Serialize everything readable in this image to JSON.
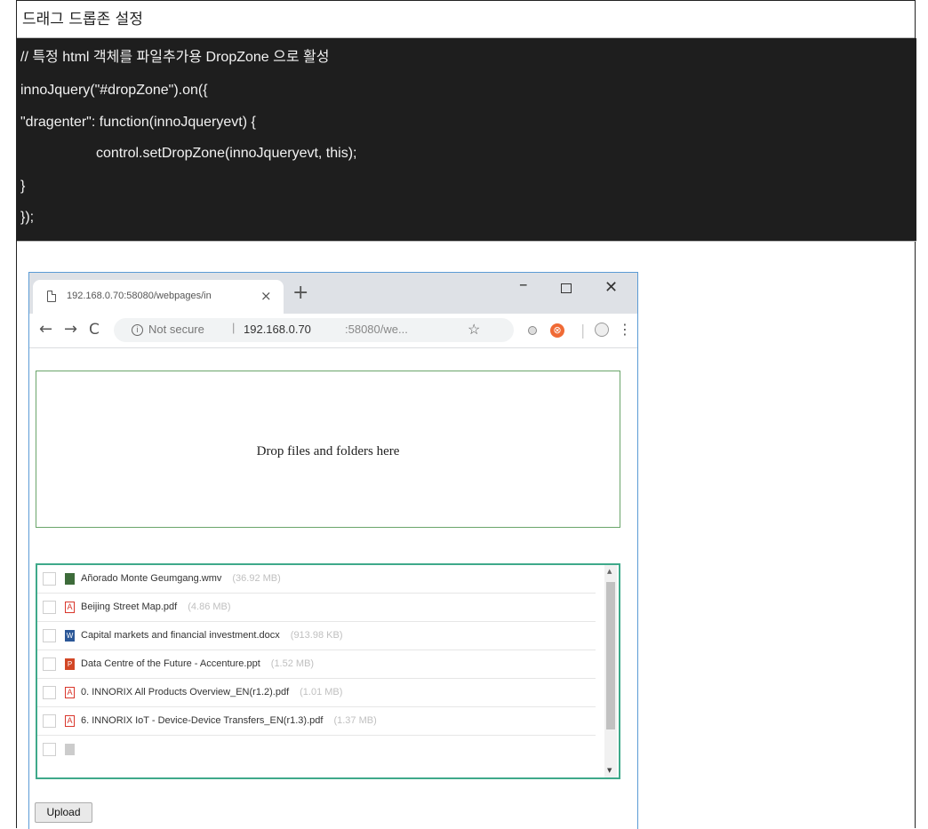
{
  "heading": "드래그 드롭존 설정",
  "code_lines": [
    "// 특정 html 객체를 파일추가용 DropZone 으로 활성",
    "innoJquery(\"#dropZone\").on({",
    "\"dragenter\": function(innoJqueryevt) {",
    "control.setDropZone(innoJqueryevt, this);",
    "}",
    "});"
  ],
  "browser": {
    "tab_title": "192.168.0.70:58080/webpages/in",
    "tab_close": "×",
    "new_tab": "+",
    "window_minimize": "–",
    "window_close": "✕",
    "nav_back": "←",
    "nav_forward": "→",
    "nav_reload": "C",
    "info_glyph": "i",
    "not_secure": "Not secure",
    "url_separator": "|",
    "url_host": "192.168.0.70",
    "url_rest": ":58080/we...",
    "star": "☆",
    "extension_glyph": "⊗",
    "toolbar_separator": "|",
    "menu": "⋮"
  },
  "dropzone_text": "Drop files and folders here",
  "files": [
    {
      "name": "Añorado Monte Geumgang.wmv",
      "size": "(36.92 MB)",
      "icon": "video-icon",
      "color": "#3d6b3a"
    },
    {
      "name": "Beijing Street Map.pdf",
      "size": "(4.86 MB)",
      "icon": "pdf-icon",
      "color": "#d9362b"
    },
    {
      "name": "Capital markets and financial investment.docx",
      "size": "(913.98 KB)",
      "icon": "word-icon",
      "color": "#2b5797"
    },
    {
      "name": "Data Centre of the Future - Accenture.ppt",
      "size": "(1.52 MB)",
      "icon": "ppt-icon",
      "color": "#d24726"
    },
    {
      "name": "0. INNORIX All Products Overview_EN(r1.2).pdf",
      "size": "(1.01 MB)",
      "icon": "pdf-icon",
      "color": "#d9362b"
    },
    {
      "name": "6. INNORIX IoT - Device-Device Transfers_EN(r1.3).pdf",
      "size": "(1.37 MB)",
      "icon": "pdf-icon",
      "color": "#d9362b"
    }
  ],
  "upload_label": "Upload"
}
